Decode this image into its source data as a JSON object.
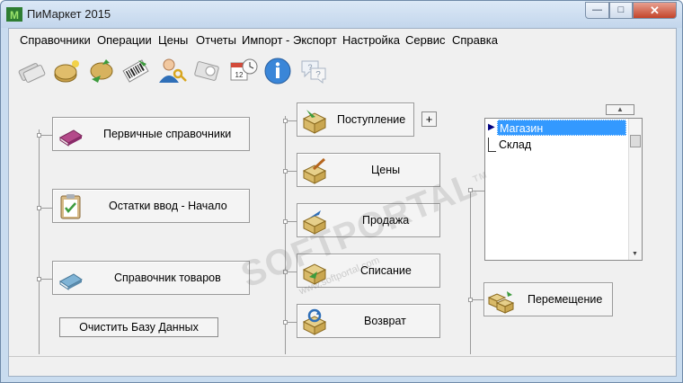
{
  "window": {
    "title": "ПиМаркет 2015",
    "min_glyph": "—",
    "max_glyph": "□",
    "close_glyph": "✕"
  },
  "menu": [
    "Справочники",
    "Операции",
    "Цены",
    "Отчеты",
    "Импорт - Экспорт",
    "Настройка",
    "Сервис",
    "Справка"
  ],
  "toolbar": {
    "icons": [
      "money-notes-icon",
      "coins-icon",
      "coin-transfer-icon",
      "barcode-icon",
      "user-key-icon",
      "discount-card-icon",
      "calendar-clock-icon",
      "info-icon",
      "help-icon"
    ]
  },
  "left_column": {
    "primary_refs": "Первичные справочники",
    "balances": "Остатки ввод - Начало",
    "goods_ref": "Справочник товаров",
    "clear_db": "Очистить Базу Данных"
  },
  "middle_column": {
    "receipt": "Поступление",
    "plus": "+",
    "prices": "Цены",
    "sale": "Продажа",
    "writeoff": "Списание",
    "return": "Возврат"
  },
  "right_column": {
    "collapse_glyph": "▲",
    "stores": [
      {
        "name": "Магазин",
        "selected": true
      },
      {
        "name": "Склад",
        "selected": false
      }
    ],
    "scroll_down_glyph": "▼",
    "transfer": "Перемещение"
  },
  "watermark": {
    "main": "SOFTPORTAL",
    "sub": "www.softportal.com",
    "tm": "TM"
  },
  "colors": {
    "title_bg": "#c9dcef",
    "close_red": "#c3442a",
    "selected_row": "#3399ff"
  }
}
